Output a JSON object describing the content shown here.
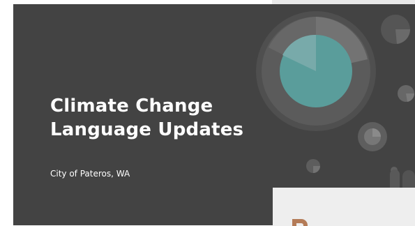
{
  "slide": {
    "title_line1": "Climate Change",
    "title_line2": "Language Updates",
    "subtitle": "City of Pateros, WA"
  },
  "colors": {
    "slide_background": "#434343",
    "accent_teal": "#5a9d9b",
    "title_text": "#ffffff",
    "next_slide_accent": "#b47b57"
  },
  "icons": {
    "main_decoration": "concentric-circle-decoration",
    "small_decorations": "small-circle-decorations"
  }
}
